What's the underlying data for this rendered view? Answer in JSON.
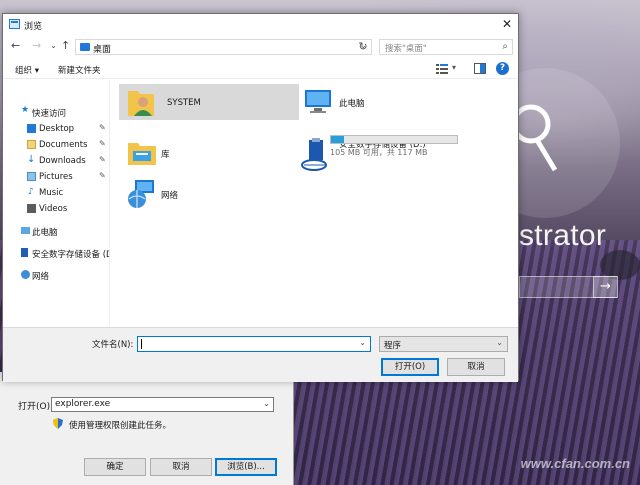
{
  "browse_dialog": {
    "title": "浏览",
    "address": {
      "location": "桌面"
    },
    "search_placeholder": "搜索\"桌面\"",
    "toolbar": {
      "organize": "组织 ▾",
      "new_folder": "新建文件夹"
    },
    "nav_pane": {
      "quick_access": "快速访问",
      "items": [
        {
          "label": "Desktop",
          "pinned": true
        },
        {
          "label": "Documents",
          "pinned": true
        },
        {
          "label": "Downloads",
          "pinned": true
        },
        {
          "label": "Pictures",
          "pinned": true
        },
        {
          "label": "Music",
          "pinned": false
        },
        {
          "label": "Videos",
          "pinned": false
        }
      ],
      "this_pc": "此电脑",
      "removable": "安全数字存储设备 (D",
      "network": "网络"
    },
    "content": {
      "items": [
        {
          "label": "SYSTEM",
          "icon": "user-folder-icon",
          "selected": true
        },
        {
          "label": "此电脑",
          "icon": "computer-icon"
        },
        {
          "label": "库",
          "icon": "library-icon"
        },
        {
          "label": "安全数字存储设备 (D:)",
          "icon": "usb-drive-icon",
          "free_text": "105 MB 可用，共 117 MB",
          "used_fraction": 0.1
        },
        {
          "label": "网络",
          "icon": "network-icon"
        }
      ]
    },
    "filename_label": "文件名(N):",
    "filename_value": "",
    "filetype_value": "程序",
    "open_button": "打开(O)",
    "cancel_button": "取消"
  },
  "run_dialog": {
    "open_label": "打开(O):",
    "open_value": "explorer.exe",
    "admin_note": "使用管理权限创建此任务。",
    "ok_button": "确定",
    "cancel_button": "取消",
    "browse_button": "浏览(B)..."
  },
  "login_screen": {
    "user_name_partial": "strator",
    "submit_arrow": "→"
  },
  "watermark": "www.cfan.com.cn",
  "colors": {
    "accent": "#0078d7",
    "drive_bar": "#26a0da",
    "selection": "#d9d9d9"
  }
}
